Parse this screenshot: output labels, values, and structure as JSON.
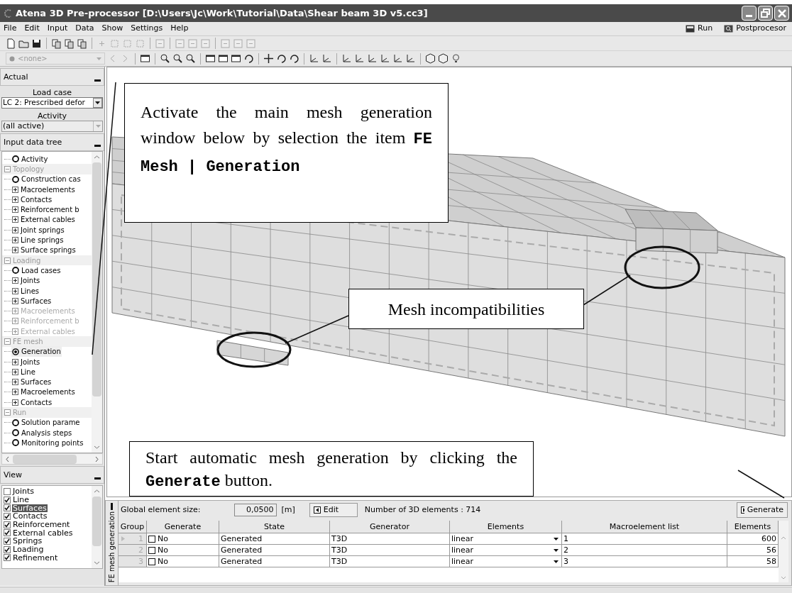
{
  "window": {
    "title": "Atena 3D Pre-processor [D:\\Users\\Jc\\Work\\Tutorial\\Data\\Shear beam 3D v5.cc3]"
  },
  "menu": [
    {
      "label": "File"
    },
    {
      "label": "Edit"
    },
    {
      "label": "Input"
    },
    {
      "label": "Data"
    },
    {
      "label": "Show"
    },
    {
      "label": "Settings"
    },
    {
      "label": "Help"
    }
  ],
  "menu_actions": [
    {
      "kind": "run",
      "label": "Run"
    },
    {
      "kind": "post",
      "label": "Postprocesor"
    }
  ],
  "toolbar": {
    "object_combo": "<none>"
  },
  "actual": {
    "title": "Actual",
    "load_case_label": "Load case",
    "load_case": "LC 2: Prescribed defor",
    "activity_label": "Activity",
    "activity": "(all active)"
  },
  "tree": {
    "title": "Input data tree",
    "items": [
      {
        "kind": "node",
        "label": "Activity",
        "disabled": false,
        "selected": false
      },
      {
        "kind": "section",
        "label": "Topology",
        "expanded": true,
        "children": [
          {
            "kind": "node",
            "label": "Construction cas",
            "disabled": false,
            "selected": false
          },
          {
            "kind": "group",
            "label": "Macroelements",
            "disabled": false,
            "selected": false
          },
          {
            "kind": "group",
            "label": "Contacts",
            "disabled": false,
            "selected": false
          },
          {
            "kind": "group",
            "label": "Reinforcement b",
            "disabled": false,
            "selected": false
          },
          {
            "kind": "group",
            "label": "External cables",
            "disabled": false,
            "selected": false
          },
          {
            "kind": "group",
            "label": "Joint springs",
            "disabled": false,
            "selected": false
          },
          {
            "kind": "group",
            "label": "Line springs",
            "disabled": false,
            "selected": false
          },
          {
            "kind": "group",
            "label": "Surface springs",
            "disabled": false,
            "selected": false
          }
        ]
      },
      {
        "kind": "section",
        "label": "Loading",
        "expanded": true,
        "children": [
          {
            "kind": "node",
            "label": "Load cases",
            "disabled": false,
            "selected": false
          },
          {
            "kind": "group",
            "label": "Joints",
            "disabled": false,
            "selected": false
          },
          {
            "kind": "group",
            "label": "Lines",
            "disabled": false,
            "selected": false
          },
          {
            "kind": "group",
            "label": "Surfaces",
            "disabled": false,
            "selected": false
          },
          {
            "kind": "group",
            "label": "Macroelements",
            "disabled": true,
            "selected": false
          },
          {
            "kind": "group",
            "label": "Reinforcement b",
            "disabled": true,
            "selected": false
          },
          {
            "kind": "group",
            "label": "External cables",
            "disabled": true,
            "selected": false
          }
        ]
      },
      {
        "kind": "section",
        "label": "FE mesh",
        "expanded": true,
        "children": [
          {
            "kind": "node",
            "label": "Generation",
            "disabled": false,
            "selected": true
          },
          {
            "kind": "group",
            "label": "Joints",
            "disabled": false,
            "selected": false
          },
          {
            "kind": "group",
            "label": "Line",
            "disabled": false,
            "selected": false
          },
          {
            "kind": "group",
            "label": "Surfaces",
            "disabled": false,
            "selected": false
          },
          {
            "kind": "group",
            "label": "Macroelements",
            "disabled": false,
            "selected": false
          },
          {
            "kind": "group",
            "label": "Contacts",
            "disabled": false,
            "selected": false
          }
        ]
      },
      {
        "kind": "section",
        "label": "Run",
        "expanded": true,
        "children": [
          {
            "kind": "node",
            "label": "Solution parame",
            "disabled": false,
            "selected": false
          },
          {
            "kind": "node",
            "label": "Analysis steps",
            "disabled": false,
            "selected": false
          },
          {
            "kind": "node",
            "label": "Monitoring points",
            "disabled": false,
            "selected": false
          }
        ]
      }
    ]
  },
  "view": {
    "title": "View",
    "items": [
      {
        "label": "Joints",
        "checked": false,
        "selected": false
      },
      {
        "label": "Line",
        "checked": true,
        "selected": false
      },
      {
        "label": "Surfaces",
        "checked": true,
        "selected": true
      },
      {
        "label": "Contacts",
        "checked": true,
        "selected": false
      },
      {
        "label": "Reinforcement",
        "checked": true,
        "selected": false
      },
      {
        "label": "External cables",
        "checked": true,
        "selected": false
      },
      {
        "label": "Springs",
        "checked": true,
        "selected": false
      },
      {
        "label": "Loading",
        "checked": true,
        "selected": false
      },
      {
        "label": "Refinement",
        "checked": true,
        "selected": false
      }
    ]
  },
  "callouts": [
    {
      "text": "Activate the main mesh generation window below by selection the item **FE Mesh | Generation**"
    },
    {
      "text": "Mesh incompatibilities"
    },
    {
      "text": "Start automatic mesh generation by clicking the **Generate** button."
    }
  ],
  "mesh_panel": {
    "tab": "FE mesh generation",
    "size_label": "Global element size:",
    "size_value": "0,0500",
    "unit": "[m]",
    "edit_button": "Edit",
    "count_text": "Number of 3D elements : 714",
    "generate_button": "Generate",
    "columns": [
      "Group",
      "Generate",
      "State",
      "Generator",
      "Elements",
      "Macroelement list",
      "Elements"
    ],
    "rows": [
      {
        "group": "1",
        "current": true,
        "generate": {
          "checked": false,
          "label": "No"
        },
        "state": "Generated",
        "generator": "T3D",
        "elements": "linear",
        "macroelements": "1",
        "count": "600"
      },
      {
        "group": "2",
        "current": false,
        "generate": {
          "checked": false,
          "label": "No"
        },
        "state": "Generated",
        "generator": "T3D",
        "elements": "linear",
        "macroelements": "2",
        "count": "56"
      },
      {
        "group": "3",
        "current": false,
        "generate": {
          "checked": false,
          "label": "No"
        },
        "state": "Generated",
        "generator": "T3D",
        "elements": "linear",
        "macroelements": "3",
        "count": "58"
      }
    ]
  }
}
